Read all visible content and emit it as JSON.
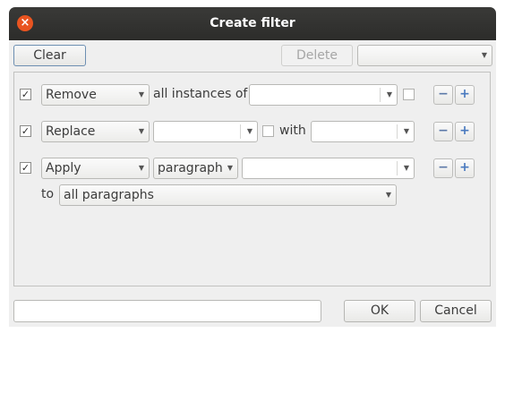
{
  "window": {
    "title": "Create filter",
    "close_glyph": "×"
  },
  "toolbar": {
    "clear_label": "Clear",
    "delete_label": "Delete",
    "filter_select_value": ""
  },
  "rows": [
    {
      "checked": true,
      "action": "Remove",
      "text": "all instances of",
      "value": "",
      "option_checked": false
    },
    {
      "checked": true,
      "action": "Replace",
      "value": "",
      "option_checked": false,
      "with_label": "with",
      "with_value": ""
    },
    {
      "checked": true,
      "action": "Apply",
      "target": "paragraph",
      "value": "",
      "to_label": "to",
      "scope": "all paragraphs"
    }
  ],
  "footer": {
    "name_value": "",
    "ok_label": "OK",
    "cancel_label": "Cancel"
  },
  "icons": {
    "check": "✓",
    "minus": "−",
    "plus": "+",
    "dropdown": "▼"
  },
  "colors": {
    "close_button": "#e95420",
    "titlebar": "#2c2c2a",
    "accent_plus": "#4a7abf"
  }
}
